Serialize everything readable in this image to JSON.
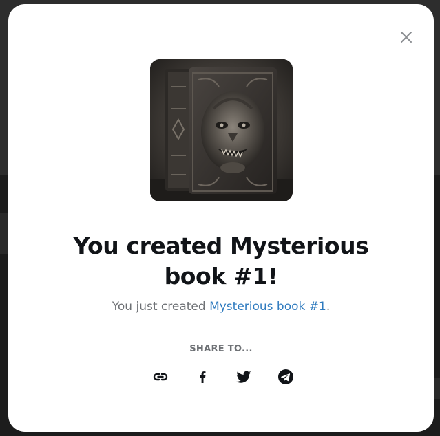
{
  "dialog": {
    "title": "You created Mysterious book #1!",
    "subtitle_prefix": "You just created ",
    "subtitle_link": "Mysterious book #1",
    "subtitle_suffix": ".",
    "share_label": "SHARE TO...",
    "close_icon": "close-icon",
    "artwork": "mysterious-book-artwork"
  },
  "share": {
    "items": [
      {
        "icon": "link-icon",
        "label": "Copy link"
      },
      {
        "icon": "facebook-icon",
        "label": "Facebook"
      },
      {
        "icon": "twitter-icon",
        "label": "Twitter"
      },
      {
        "icon": "telegram-icon",
        "label": "Telegram"
      }
    ]
  },
  "colors": {
    "link": "#2f7bbf",
    "title": "#111418",
    "muted": "#6e7175",
    "backdrop": "#2b2b2b"
  }
}
